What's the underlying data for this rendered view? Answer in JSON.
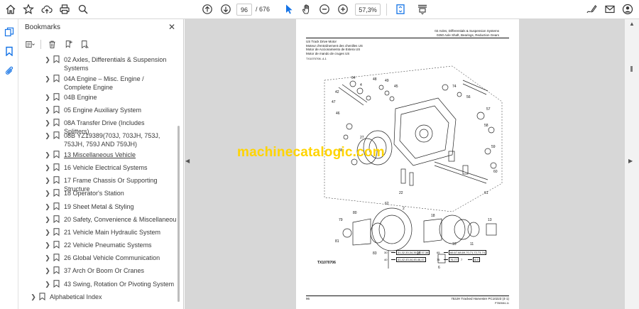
{
  "toolbar": {
    "page_current": "96",
    "page_total": "/ 676",
    "zoom": "57,3%",
    "icons": [
      "home-icon",
      "star-icon",
      "cloud-upload-icon",
      "print-icon",
      "zoom-search-icon",
      "page-up-icon",
      "page-down-icon",
      "select-cursor-icon",
      "hand-icon",
      "zoom-out-icon",
      "zoom-in-icon",
      "fit-page-icon",
      "scroll-mode-icon",
      "sign-icon",
      "email-icon",
      "user-icon"
    ],
    "accent": "#1473e6"
  },
  "rail": {
    "icons": [
      "page-thumbnails-icon",
      "bookmark-icon",
      "attachment-icon"
    ]
  },
  "bookmarks": {
    "title": "Bookmarks",
    "items": [
      {
        "label": "02 Axles, Differentials & Suspension Systems",
        "underlined": false
      },
      {
        "label": "04A Engine – Misc. Engine / Complete Engine",
        "underlined": false
      },
      {
        "label": "04B Engine",
        "underlined": false
      },
      {
        "label": "05 Engine Auxiliary System",
        "underlined": false
      },
      {
        "label": "08A Transfer Drive (Includes Splitters)",
        "underlined": false
      },
      {
        "label": "08B YZ19389(703J, 703JH, 753J, 753JH, 759J AND 759JH)",
        "underlined": false
      },
      {
        "label": "13 Miscellaneous Vehicle",
        "underlined": true
      },
      {
        "label": "16 Vehicle Electrical Systems",
        "underlined": false
      },
      {
        "label": "17 Frame Chassis Or Supporting Structure",
        "underlined": false
      },
      {
        "label": "18 Operator's Station",
        "underlined": false
      },
      {
        "label": "19 Sheet Metal & Styling",
        "underlined": false
      },
      {
        "label": "20 Safety, Convenience & Miscellaneous",
        "underlined": false
      },
      {
        "label": "21 Vehicle Main Hydraulic System",
        "underlined": false
      },
      {
        "label": "22 Vehicle Pneumatic Systems",
        "underlined": false
      },
      {
        "label": "26 Global Vehicle Communication",
        "underlined": false
      },
      {
        "label": "37 Arch Or Boom Or Cranes",
        "underlined": false
      },
      {
        "label": "43 Swing, Rotation Or Pivoting System",
        "underlined": false
      }
    ],
    "root_item": "Alphabetical Index"
  },
  "document": {
    "header_line1": "02 Axles, Differentials & Suspension Systems",
    "header_line2": "0250 Axle Shaft, Bearings, Reduction Gears",
    "title_lines": [
      "US Track Drive Motor",
      "Moteur d'entraînement des chenilles US",
      "Motor de Accionamiento de Estera US",
      "Motor de mando de cruges US"
    ],
    "ref_code": "TX1070706 -4-1",
    "diagram_code": "TX1070706",
    "refs": [
      {
        "n": "30",
        "box": "31,32,33,34,35,36,37,38"
      },
      {
        "n": "40",
        "box": "41,42,43,44,45,46,47"
      },
      {
        "n": "65",
        "box": "66,67,68,69,70,71,72,73,74"
      },
      {
        "n": "75",
        "box": "76,77"
      },
      {
        "n": "7",
        "box": "8,9"
      }
    ],
    "footer_left": "96",
    "footer_right": "753JH Tracked Harvester   PC10223   (4-1)",
    "footer_right2": "PT809M4-11",
    "watermark": "machinecatalogic.com"
  }
}
